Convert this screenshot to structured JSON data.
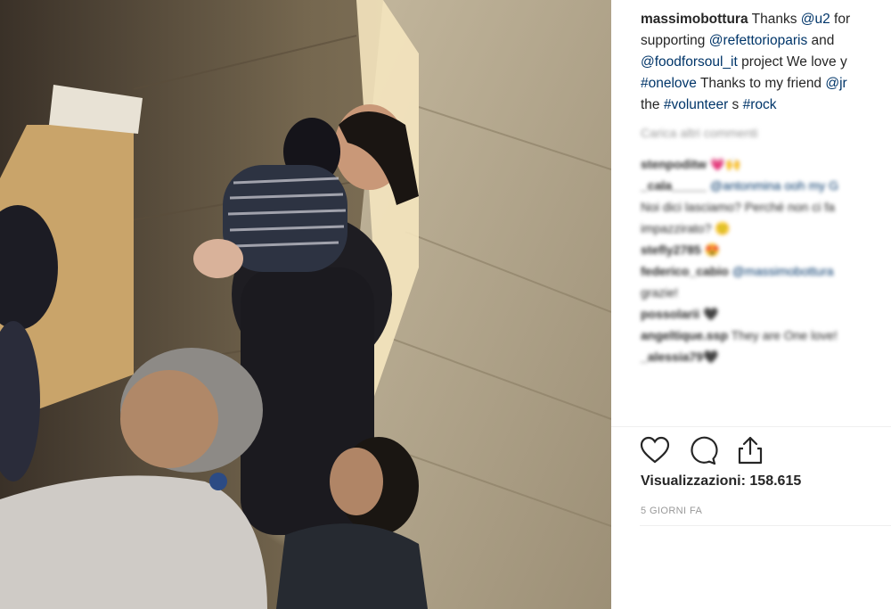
{
  "post": {
    "username": "massimobottura",
    "caption_parts": [
      {
        "kind": "user",
        "text": "massimobottura"
      },
      {
        "kind": "text",
        "text": " Thanks "
      },
      {
        "kind": "link",
        "text": "@u2"
      },
      {
        "kind": "text",
        "text": " for"
      },
      {
        "kind": "br"
      },
      {
        "kind": "text",
        "text": "supporting "
      },
      {
        "kind": "link",
        "text": "@refettorioparis"
      },
      {
        "kind": "text",
        "text": " and"
      },
      {
        "kind": "br"
      },
      {
        "kind": "link",
        "text": "@foodforsoul_it"
      },
      {
        "kind": "text",
        "text": " project We love y"
      },
      {
        "kind": "br"
      },
      {
        "kind": "link",
        "text": "#onelove"
      },
      {
        "kind": "text",
        "text": " Thanks to my friend "
      },
      {
        "kind": "link",
        "text": "@jr"
      },
      {
        "kind": "br"
      },
      {
        "kind": "text",
        "text": "the "
      },
      {
        "kind": "link",
        "text": "#volunteer"
      },
      {
        "kind": "text",
        "text": " s "
      },
      {
        "kind": "link",
        "text": "#rock"
      }
    ]
  },
  "load_more_label": "Carica altri commenti",
  "comments": [
    {
      "user": "stenpoditw",
      "text": " 💗🙌",
      "link": ""
    },
    {
      "user": "_cala_____",
      "text": "",
      "link": " @antonmina ooh my G"
    },
    {
      "user": "",
      "text": "Noi dici lasciamo? Perché non ci fa",
      "link": ""
    },
    {
      "user": "",
      "text": "impazzirato? 🙂",
      "link": ""
    },
    {
      "user": "stefly2785",
      "text": " 😍",
      "link": ""
    },
    {
      "user": "federico_cabio",
      "text": "",
      "link": " @massimobottura"
    },
    {
      "user": "",
      "text": "grazie!",
      "link": ""
    },
    {
      "user": "possolarii",
      "text": " 🖤",
      "link": ""
    },
    {
      "user": "angeltique.ssp",
      "text": " They are One love!",
      "link": ""
    },
    {
      "user": "_alessia79",
      "text": "🖤",
      "link": ""
    }
  ],
  "actions": {
    "icons": [
      "heart-icon",
      "comment-icon",
      "share-icon"
    ],
    "views_label": "Visualizzazioni:",
    "views_count": "158.615",
    "date": "5 GIORNI FA"
  },
  "colors": {
    "link": "#003569",
    "text": "#262626",
    "muted": "#999999",
    "divider": "#efefef"
  }
}
